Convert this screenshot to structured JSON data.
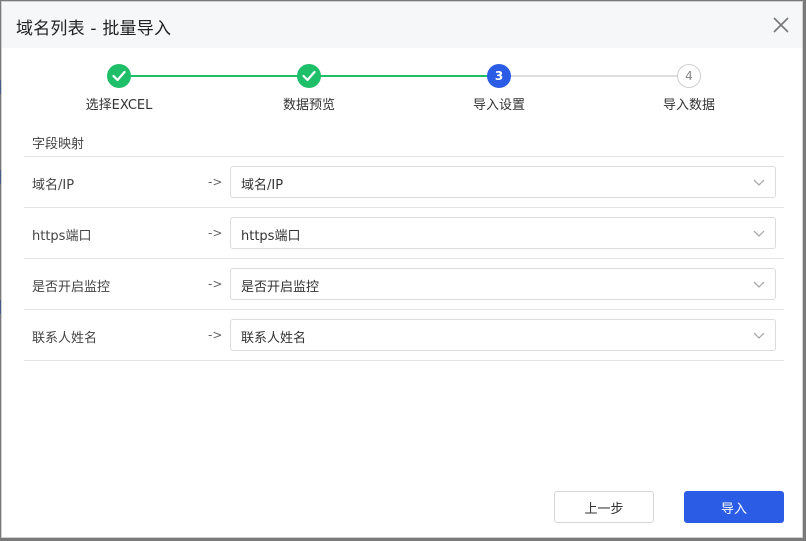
{
  "dialog": {
    "title": "域名列表 - 批量导入"
  },
  "steps": [
    {
      "label": "选择EXCEL",
      "state": "done",
      "number": ""
    },
    {
      "label": "数据预览",
      "state": "done",
      "number": ""
    },
    {
      "label": "导入设置",
      "state": "active",
      "number": "3"
    },
    {
      "label": "导入数据",
      "state": "todo",
      "number": "4"
    }
  ],
  "mapping": {
    "section_title": "字段映射",
    "arrow": "->",
    "rows": [
      {
        "field": "域名/IP",
        "value": "域名/IP"
      },
      {
        "field": "https端口",
        "value": "https端口"
      },
      {
        "field": "是否开启监控",
        "value": "是否开启监控"
      },
      {
        "field": "联系人姓名",
        "value": "联系人姓名"
      }
    ]
  },
  "footer": {
    "prev_label": "上一步",
    "import_label": "导入"
  },
  "colors": {
    "done": "#1fbf6a",
    "active": "#2b5ce6",
    "todo": "#cfcfcf"
  }
}
